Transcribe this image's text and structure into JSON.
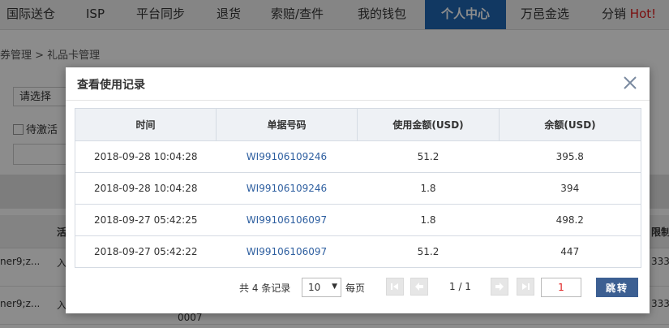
{
  "nav": {
    "items": [
      "国际送仓",
      "ISP",
      "平台同步",
      "退货",
      "索赔/查件",
      "我的钱包",
      "个人中心",
      "万邑金选",
      "分销"
    ],
    "hot_label": "Hot!",
    "active_index": 6
  },
  "page": {
    "breadcrumb": "券管理 > 礼品卡管理",
    "select_value": "请选择",
    "checkbox_label": "待激活",
    "column_fragment_left": "活",
    "column_fragment_right": "限制说",
    "rows": [
      {
        "left": "ner9;z...",
        "mid": "入",
        "right": "3334"
      },
      {
        "left": "ner9;z...",
        "mid": "入",
        "right": "3334"
      }
    ],
    "trailing_code": "0007"
  },
  "modal": {
    "title": "查看使用记录",
    "columns": [
      "时间",
      "单据号码",
      "使用金额(USD)",
      "余额(USD)"
    ],
    "rows": [
      {
        "time": "2018-09-28 10:04:28",
        "doc_no": "WI99106109246",
        "amount": "51.2",
        "balance": "395.8"
      },
      {
        "time": "2018-09-28 10:04:28",
        "doc_no": "WI99106109246",
        "amount": "1.8",
        "balance": "394"
      },
      {
        "time": "2018-09-27 05:42:25",
        "doc_no": "WI99106106097",
        "amount": "1.8",
        "balance": "498.2"
      },
      {
        "time": "2018-09-27 05:42:22",
        "doc_no": "WI99106106097",
        "amount": "51.2",
        "balance": "447"
      }
    ],
    "pager": {
      "total": "共 4 条记录",
      "page_size": "10",
      "per_page_label": "每页",
      "page_info": "1 / 1",
      "jump_value": "1",
      "go_label": "跳转"
    }
  },
  "colors": {
    "nav_active": "#1f66b3",
    "hot": "#e01c1c",
    "link": "#2e5fa0",
    "go_button": "#3c5f92"
  }
}
